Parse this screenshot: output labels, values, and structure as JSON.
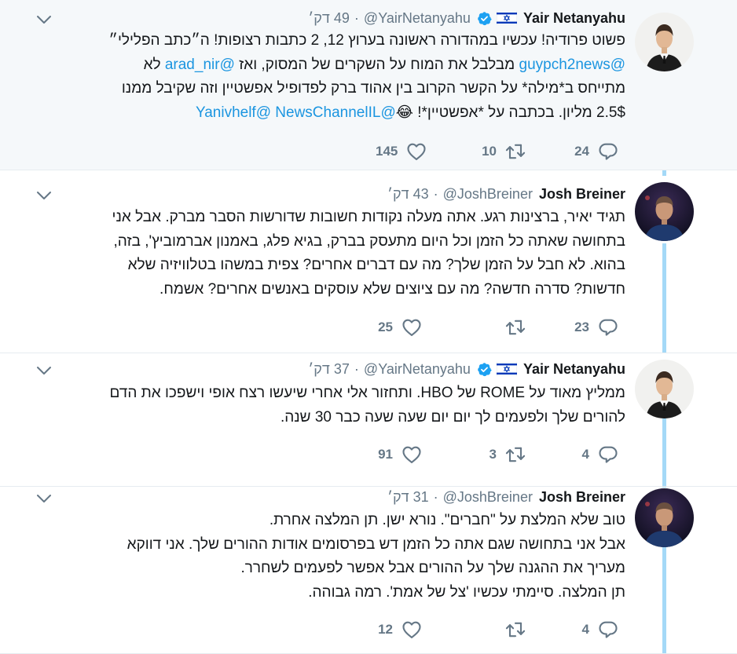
{
  "tweets": [
    {
      "name": "Yair Netanyahu",
      "handle": "@YairNetanyahu",
      "dot": "·",
      "time": "49 דק׳",
      "verified": true,
      "lines": [
        [
          {
            "t": "פשוט פרודיה! עכשיו במהדורה ראשונה בערוץ 12, 2 כתבות רצופות! ה״כתב הפלילי״",
            "m": false
          }
        ],
        [
          {
            "t": "@guypch2news",
            "m": true
          },
          {
            "t": " מבלבל את המוח על השקרים של המסוק, ואז ",
            "m": false
          },
          {
            "t": "@arad_nir",
            "m": true
          },
          {
            "t": " לא",
            "m": false
          }
        ],
        [
          {
            "t": "מתייחס ב*מילה* על הקשר הקרוב  בין אהוד ברק לפדופיל אפשטיין וזה שקיבל ממנו",
            "m": false
          }
        ],
        [
          {
            "t": "2.5$ מליון. בכתבה על *אפשטיין*! 😂",
            "m": false
          },
          {
            "t": "@NewsChannelIL",
            "m": true
          },
          {
            "t": " ",
            "m": false
          },
          {
            "t": "@Yanivhelf",
            "m": true
          }
        ]
      ],
      "reply_count": "24",
      "retweet_count": "10",
      "like_count": "145"
    },
    {
      "name": "Josh Breiner",
      "handle": "@JoshBreiner",
      "dot": "·",
      "time": "43 דק׳",
      "verified": false,
      "lines": [
        [
          {
            "t": "תגיד יאיר, ברצינות רגע. אתה מעלה נקודות חשובות שדורשות הסבר מברק. אבל אני",
            "m": false
          }
        ],
        [
          {
            "t": "בתחושה שאתה כל הזמן וכל היום מתעסק בברק, בגיא פלג, באמנון אברמוביץ', בזה,",
            "m": false
          }
        ],
        [
          {
            "t": "בהוא. לא חבל על הזמן שלך? מה עם דברים אחרים? צפית במשהו בטלוויזיה שלא",
            "m": false
          }
        ],
        [
          {
            "t": "חדשות? סדרה חדשה? מה עם ציוצים שלא עוסקים באנשים אחרים? אשמח.",
            "m": false
          }
        ]
      ],
      "reply_count": "23",
      "retweet_count": "",
      "like_count": "25"
    },
    {
      "name": "Yair Netanyahu",
      "handle": "@YairNetanyahu",
      "dot": "·",
      "time": "37 דק׳",
      "verified": true,
      "lines": [
        [
          {
            "t": "ממליץ מאוד על ROME של HBO. ותחזור אלי אחרי שיעשו רצח אופי וישפכו את הדם",
            "m": false
          }
        ],
        [
          {
            "t": "להורים שלך ולפעמים לך יום יום שעה שעה כבר 30 שנה.",
            "m": false
          }
        ]
      ],
      "reply_count": "4",
      "retweet_count": "3",
      "like_count": "91"
    },
    {
      "name": "Josh Breiner",
      "handle": "@JoshBreiner",
      "dot": "·",
      "time": "31 דק׳",
      "verified": false,
      "lines": [
        [
          {
            "t": "טוב שלא המלצת על \"חברים\". נורא ישן. תן המלצה אחרת.",
            "m": false
          }
        ],
        [
          {
            "t": "אבל אני בתחושה שגם אתה כל הזמן דש בפרסומים אודות ההורים שלך. אני דווקא",
            "m": false
          }
        ],
        [
          {
            "t": "מעריך את ההגנה שלך על ההורים אבל אפשר לפעמים לשחרר.",
            "m": false
          }
        ],
        [
          {
            "t": "תן המלצה. סיימתי עכשיו 'צל של אמת'. רמה גבוהה.",
            "m": false
          }
        ]
      ],
      "reply_count": "4",
      "retweet_count": "",
      "like_count": "12"
    }
  ],
  "icons": {
    "reply": "reply-icon",
    "retweet": "retweet-icon",
    "like": "like-icon",
    "chevron": "chevron-down-icon",
    "verified": "verified-badge-icon",
    "flag": "israel-flag-icon"
  },
  "colors": {
    "mention": "#1b95e0",
    "muted": "#657786",
    "highlight_bg": "#f5f8fa",
    "thread_line": "#a4d9f7",
    "verified": "#1da1f2"
  }
}
